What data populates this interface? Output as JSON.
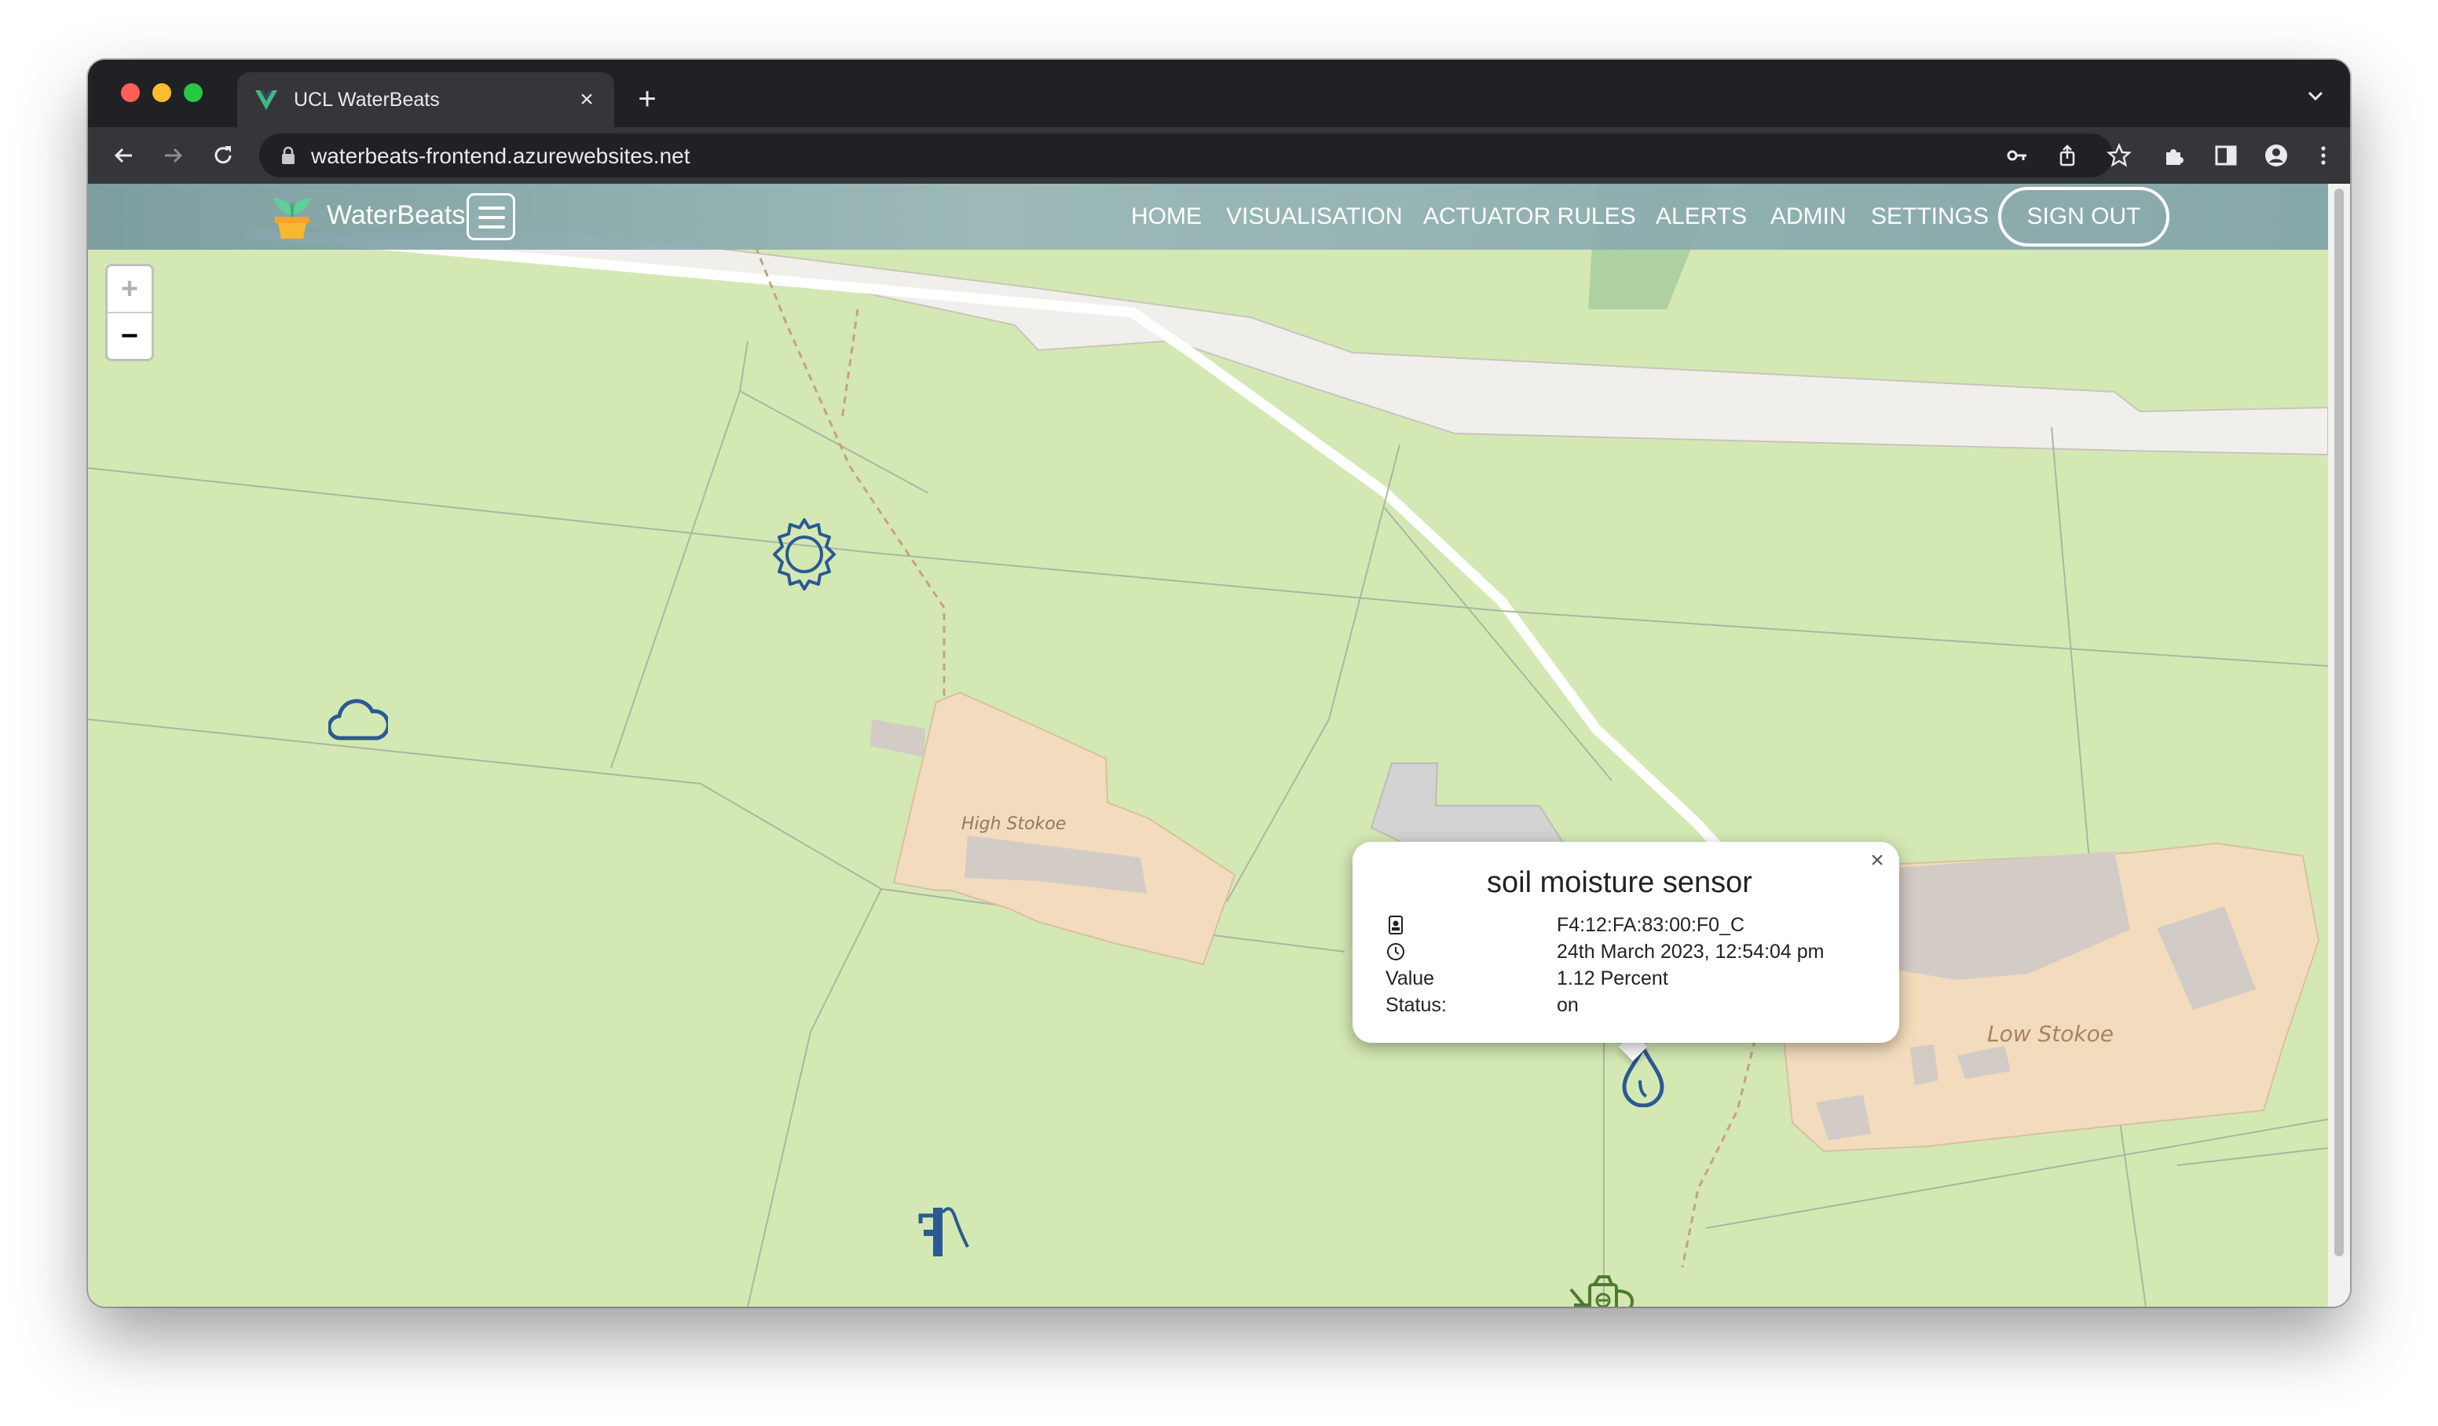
{
  "browser": {
    "tab_title": "UCL WaterBeats",
    "url": "waterbeats-frontend.azurewebsites.net",
    "favicon": "vue-logo-icon"
  },
  "app": {
    "brand": "WaterBeats",
    "nav": {
      "home": "HOME",
      "visualisation": "VISUALISATION",
      "actuator_rules": "ACTUATOR RULES",
      "alerts": "ALERTS",
      "admin": "ADMIN",
      "settings": "SETTINGS",
      "sign_out": "SIGN OUT"
    }
  },
  "map": {
    "zoom_in": "+",
    "zoom_out": "−",
    "place_labels": {
      "high_stokoe": "High Stokoe",
      "low_stokoe": "Low Stokoe"
    },
    "markers": [
      "gear-icon",
      "cloud-icon",
      "water-drop-icon",
      "water-pump-icon",
      "watering-can-icon"
    ]
  },
  "popup": {
    "title": "soil moisture sensor",
    "close": "×",
    "id_value": "F4:12:FA:83:00:F0_C",
    "time_value": "24th March 2023, 12:54:04 pm",
    "value_label": "Value",
    "value_value": "1.12 Percent",
    "status_label": "Status:",
    "status_value": "on"
  },
  "colors": {
    "map_land": "#d4e8b4",
    "farm_area": "#f2dcbd",
    "building": "#d3cbc5",
    "road_area": "#f1efeb",
    "marker_blue": "#2a5a93",
    "marker_green": "#4e7a2e"
  }
}
